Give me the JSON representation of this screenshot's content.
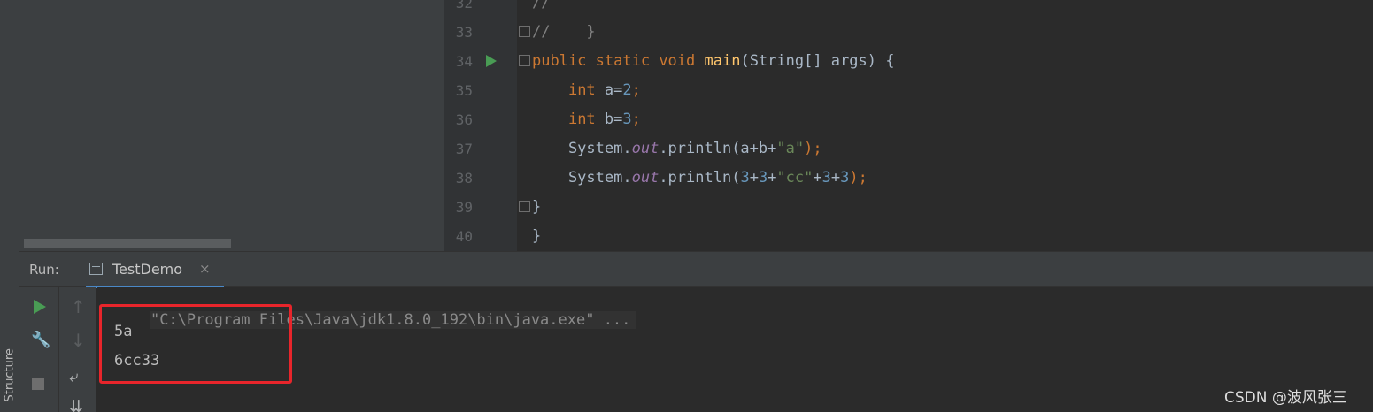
{
  "sidebar": {
    "structure_label": "Structure"
  },
  "editor": {
    "lines": [
      {
        "number": "32",
        "tokens": [
          {
            "t": "//",
            "c": "cmt"
          }
        ]
      },
      {
        "number": "33",
        "tokens": [
          {
            "t": "//    }",
            "c": "cmt"
          }
        ]
      },
      {
        "number": "34",
        "tokens": [
          {
            "t": "public ",
            "c": "kw"
          },
          {
            "t": "static ",
            "c": "kw"
          },
          {
            "t": "void ",
            "c": "kw"
          },
          {
            "t": "main",
            "c": "fn"
          },
          {
            "t": "(String[] args) {",
            "c": "plain"
          }
        ]
      },
      {
        "number": "35",
        "tokens": [
          {
            "t": "    ",
            "c": "plain"
          },
          {
            "t": "int ",
            "c": "kw"
          },
          {
            "t": "a=",
            "c": "plain"
          },
          {
            "t": "2",
            "c": "num"
          },
          {
            "t": ";",
            "c": "kw"
          }
        ]
      },
      {
        "number": "36",
        "tokens": [
          {
            "t": "    ",
            "c": "plain"
          },
          {
            "t": "int ",
            "c": "kw"
          },
          {
            "t": "b=",
            "c": "plain"
          },
          {
            "t": "3",
            "c": "num"
          },
          {
            "t": ";",
            "c": "kw"
          }
        ]
      },
      {
        "number": "37",
        "tokens": [
          {
            "t": "    System.",
            "c": "plain"
          },
          {
            "t": "out",
            "c": "fld"
          },
          {
            "t": ".println(a+b+",
            "c": "plain"
          },
          {
            "t": "\"a\"",
            "c": "str"
          },
          {
            "t": ");",
            "c": "kw"
          }
        ]
      },
      {
        "number": "38",
        "tokens": [
          {
            "t": "    System.",
            "c": "plain"
          },
          {
            "t": "out",
            "c": "fld"
          },
          {
            "t": ".println(",
            "c": "plain"
          },
          {
            "t": "3",
            "c": "num"
          },
          {
            "t": "+",
            "c": "plain"
          },
          {
            "t": "3",
            "c": "num"
          },
          {
            "t": "+",
            "c": "plain"
          },
          {
            "t": "\"cc\"",
            "c": "str"
          },
          {
            "t": "+",
            "c": "plain"
          },
          {
            "t": "3",
            "c": "num"
          },
          {
            "t": "+",
            "c": "plain"
          },
          {
            "t": "3",
            "c": "num"
          },
          {
            "t": ");",
            "c": "kw"
          }
        ]
      },
      {
        "number": "39",
        "tokens": [
          {
            "t": "}",
            "c": "plain"
          }
        ]
      },
      {
        "number": "40",
        "tokens": [
          {
            "t": "}",
            "c": "plain"
          }
        ]
      }
    ]
  },
  "run_panel": {
    "label": "Run:",
    "tab_label": "TestDemo",
    "tab_close": "×",
    "console": {
      "command": "\"C:\\Program Files\\Java\\jdk1.8.0_192\\bin\\java.exe\" ...",
      "output": [
        "5a",
        "6cc33"
      ]
    }
  },
  "toolbar_icons": [
    "rerun-icon",
    "wrench-icon",
    "stop-icon",
    "up-arrow-icon",
    "down-arrow-icon",
    "soft-wrap-icon",
    "scroll-to-end-icon"
  ],
  "watermark": "CSDN @波风张三",
  "colors": {
    "keyword": "#cc7832",
    "method": "#ffc66d",
    "number": "#6897bb",
    "string": "#6a8759",
    "field": "#9876aa",
    "highlight_box": "#e8252b",
    "run_icon": "#499c54"
  }
}
